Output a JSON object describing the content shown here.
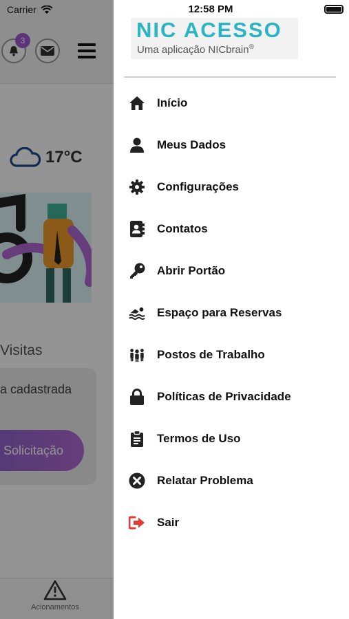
{
  "background": {
    "status_carrier": "Carrier",
    "notification_count": "3",
    "temperature": "17°C",
    "visits_title": "Visitas",
    "visit_empty_text": "a cadastrada",
    "request_button": "Solicitação",
    "bottom_tab_label": "Acionamentos"
  },
  "status_bar": {
    "time": "12:58 PM"
  },
  "brand": {
    "title": "NIC ACESSO",
    "subtitle": "Uma aplicação NICbrain",
    "registered": "®",
    "color": "#2bb5c3"
  },
  "menu": {
    "items": [
      {
        "label": "Início",
        "icon": "home-icon"
      },
      {
        "label": "Meus Dados",
        "icon": "user-icon"
      },
      {
        "label": "Configurações",
        "icon": "gear-icon"
      },
      {
        "label": "Contatos",
        "icon": "contacts-icon"
      },
      {
        "label": "Abrir Portão",
        "icon": "key-icon"
      },
      {
        "label": "Espaço para Reservas",
        "icon": "swimmer-icon"
      },
      {
        "label": "Postos de Trabalho",
        "icon": "people-group-icon"
      },
      {
        "label": "Políticas de Privacidade",
        "icon": "lock-icon"
      },
      {
        "label": "Termos de Uso",
        "icon": "clipboard-icon"
      },
      {
        "label": "Relatar Problema",
        "icon": "close-circle-icon"
      },
      {
        "label": "Sair",
        "icon": "sign-out-icon",
        "color": "#e53935"
      }
    ]
  }
}
